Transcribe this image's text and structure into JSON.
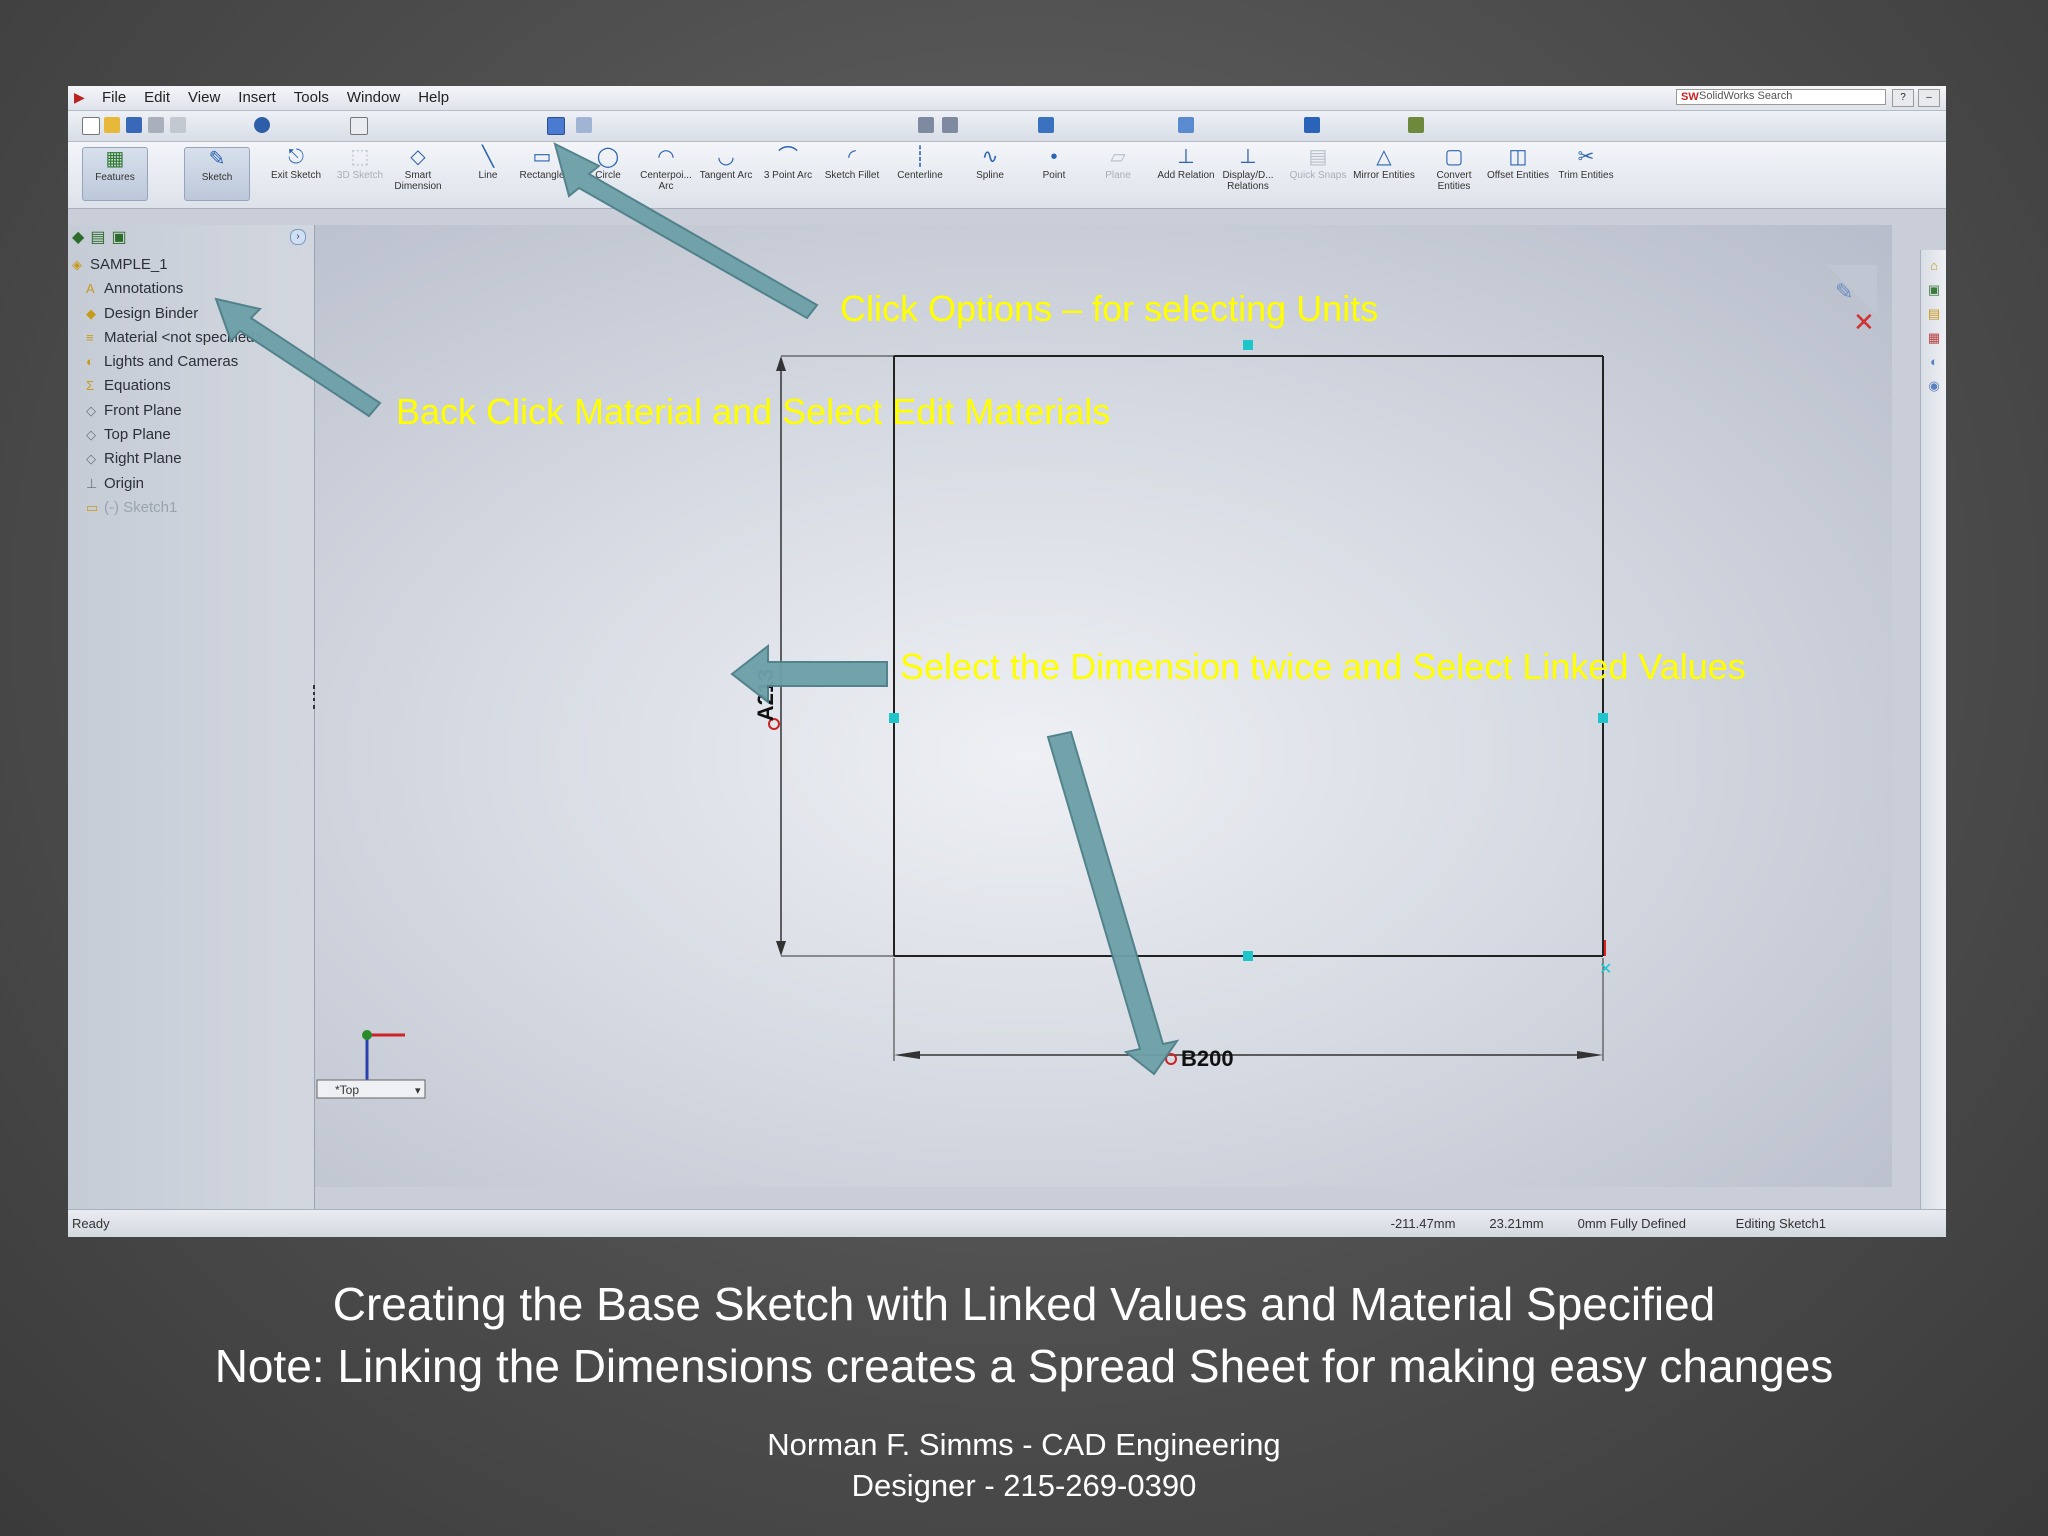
{
  "window": {
    "menus": [
      "File",
      "Edit",
      "View",
      "Insert",
      "Tools",
      "Window",
      "Help"
    ],
    "search_placeholder": "SolidWorks Search"
  },
  "command_manager": {
    "tools": [
      {
        "label": "Features",
        "icon": "features-icon"
      },
      {
        "label": "Sketch",
        "icon": "sketch-icon"
      },
      {
        "label": "Exit Sketch",
        "icon": "exit-sketch-icon"
      },
      {
        "label": "3D Sketch",
        "icon": "3d-sketch-icon",
        "disabled": true
      },
      {
        "label": "Smart Dimension",
        "icon": "smart-dimension-icon"
      },
      {
        "label": "Line",
        "icon": "line-icon"
      },
      {
        "label": "Rectangle",
        "icon": "rectangle-icon"
      },
      {
        "label": "Circle",
        "icon": "circle-icon"
      },
      {
        "label": "Centerpoi... Arc",
        "icon": "centerpoint-arc-icon"
      },
      {
        "label": "Tangent Arc",
        "icon": "tangent-arc-icon"
      },
      {
        "label": "3 Point Arc",
        "icon": "three-point-arc-icon"
      },
      {
        "label": "Sketch Fillet",
        "icon": "sketch-fillet-icon"
      },
      {
        "label": "Centerline",
        "icon": "centerline-icon"
      },
      {
        "label": "Spline",
        "icon": "spline-icon"
      },
      {
        "label": "Point",
        "icon": "point-icon"
      },
      {
        "label": "Plane",
        "icon": "plane-icon",
        "disabled": true
      },
      {
        "label": "Add Relation",
        "icon": "add-relation-icon"
      },
      {
        "label": "Display/D... Relations",
        "icon": "display-relations-icon"
      },
      {
        "label": "Quick Snaps",
        "icon": "quick-snaps-icon",
        "disabled": true
      },
      {
        "label": "Mirror Entities",
        "icon": "mirror-entities-icon"
      },
      {
        "label": "Convert Entities",
        "icon": "convert-entities-icon"
      },
      {
        "label": "Offset Entities",
        "icon": "offset-entities-icon"
      },
      {
        "label": "Trim Entities",
        "icon": "trim-entities-icon"
      }
    ]
  },
  "feature_tree": {
    "part_name": "SAMPLE_1",
    "items": [
      {
        "label": "Annotations",
        "icon": "annotations-icon"
      },
      {
        "label": "Design Binder",
        "icon": "design-binder-icon"
      },
      {
        "label": "Material <not specified>",
        "icon": "material-icon"
      },
      {
        "label": "Lights and Cameras",
        "icon": "lights-cameras-icon"
      },
      {
        "label": "Equations",
        "icon": "equations-icon"
      },
      {
        "label": "Front Plane",
        "icon": "plane-icon"
      },
      {
        "label": "Top Plane",
        "icon": "plane-icon"
      },
      {
        "label": "Right Plane",
        "icon": "plane-icon"
      },
      {
        "label": "Origin",
        "icon": "origin-icon"
      },
      {
        "label": "(-) Sketch1",
        "icon": "sketch-icon"
      }
    ]
  },
  "graphics": {
    "dim_vertical": "A213",
    "dim_horizontal": "B200",
    "view_label": "*Top"
  },
  "annotations": {
    "options": "Click Options – for selecting Units",
    "material": "Back Click Material and Select Edit Materials",
    "dimension": "Select  the Dimension twice and  Select Linked Values"
  },
  "status_bar": {
    "ready": "Ready",
    "x": "-211.47mm",
    "y": "23.21mm",
    "z": "0mm",
    "state": "Fully Defined",
    "editing": "Editing Sketch1"
  },
  "caption": {
    "line1": "Creating the Base Sketch with Linked Values and Material Specified",
    "line2": "Note: Linking the Dimensions creates a Spread Sheet for making easy changes"
  },
  "author": {
    "line1": "Norman F. Simms - CAD Engineering",
    "line2": "Designer - 215-269-0390"
  },
  "colors": {
    "annotation_text": "#ffff00",
    "arrow_fill": "#6ea0a8",
    "dimension_red": "#cc2222"
  }
}
